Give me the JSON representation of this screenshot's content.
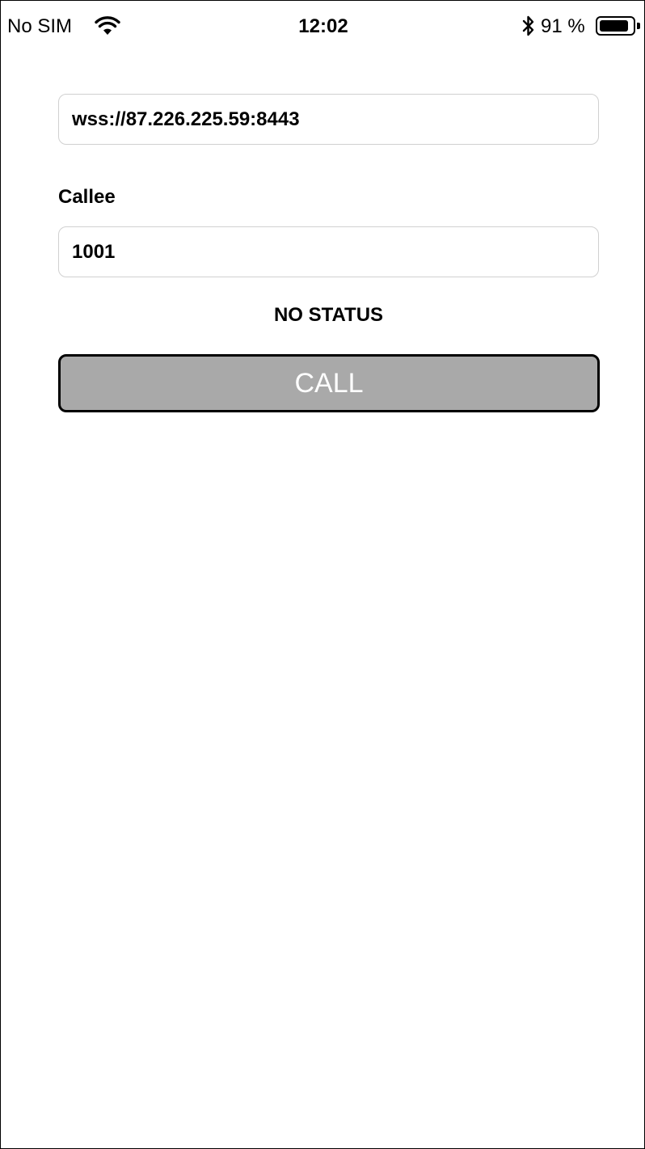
{
  "status_bar": {
    "carrier": "No SIM",
    "time": "12:02",
    "battery_percent": "91 %",
    "battery_level": 0.91,
    "icons": [
      "wifi-icon",
      "bluetooth-icon",
      "battery-icon"
    ]
  },
  "form": {
    "server_url": "wss://87.226.225.59:8443",
    "callee_label": "Callee",
    "callee_value": "1001",
    "status_text": "NO STATUS",
    "call_button_label": "CALL"
  },
  "colors": {
    "call_button_bg": "#a9a9a9",
    "call_button_text": "#ffffff",
    "field_border": "#d0d0d0"
  }
}
